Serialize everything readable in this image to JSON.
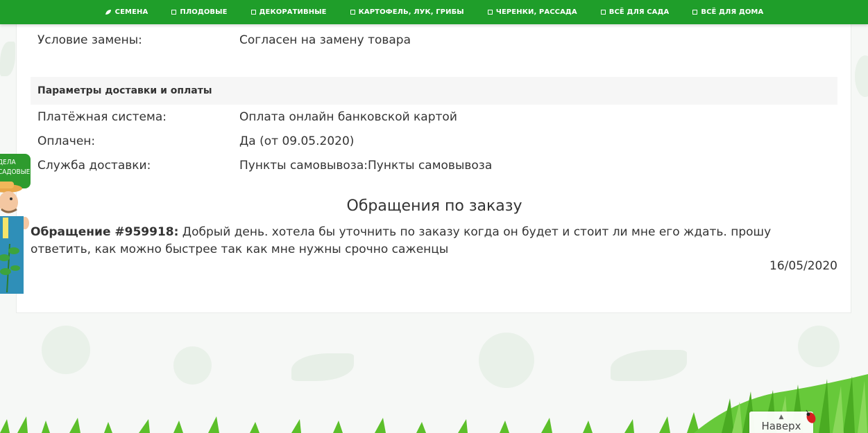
{
  "nav": {
    "items": [
      {
        "label": "СЕМЕНА",
        "icon": "leaf-icon"
      },
      {
        "label": "ПЛОДОВЫЕ",
        "icon": "square-icon"
      },
      {
        "label": "ДЕКОРАТИВНЫЕ",
        "icon": "square-icon"
      },
      {
        "label": "КАРТОФЕЛЬ, ЛУК, ГРИБЫ",
        "icon": "square-icon"
      },
      {
        "label": "ЧЕРЕНКИ, РАССАДА",
        "icon": "square-icon"
      },
      {
        "label": "ВСЁ ДЛЯ САДА",
        "icon": "square-icon"
      },
      {
        "label": "ВСЁ ДЛЯ ДОМА",
        "icon": "square-icon"
      }
    ]
  },
  "order": {
    "replacement": {
      "label": "Условие замены:",
      "value": "Согласен на замену товара"
    },
    "delivery_section_title": "Параметры доставки и оплаты",
    "payment_system": {
      "label": "Платёжная система:",
      "value": "Оплата онлайн банковской картой"
    },
    "paid": {
      "label": "Оплачен:",
      "value": "Да (от 09.05.2020)"
    },
    "delivery_service": {
      "label": "Служба доставки:",
      "value": "Пункты самовывоза:Пункты самовывоза"
    }
  },
  "appeals": {
    "title": "Обращения по заказу",
    "items": [
      {
        "number": "Обращение #959918:",
        "text": " Добрый день. хотела бы уточнить по заказу когда он будет и стоит ли мне его ждать. прошу ответить, как можно быстрее так как мне нужны срочно саженцы",
        "date": "16/05/2020"
      }
    ]
  },
  "mascot": {
    "badge_line1": "ДЕЛА",
    "badge_line2": "САДОВЫЕ"
  },
  "to_top": {
    "arrow": "▲",
    "label": "Наверх"
  },
  "colors": {
    "nav_green": "#1f9e2a",
    "text": "#333333",
    "section_bg": "#f6f6f6"
  }
}
